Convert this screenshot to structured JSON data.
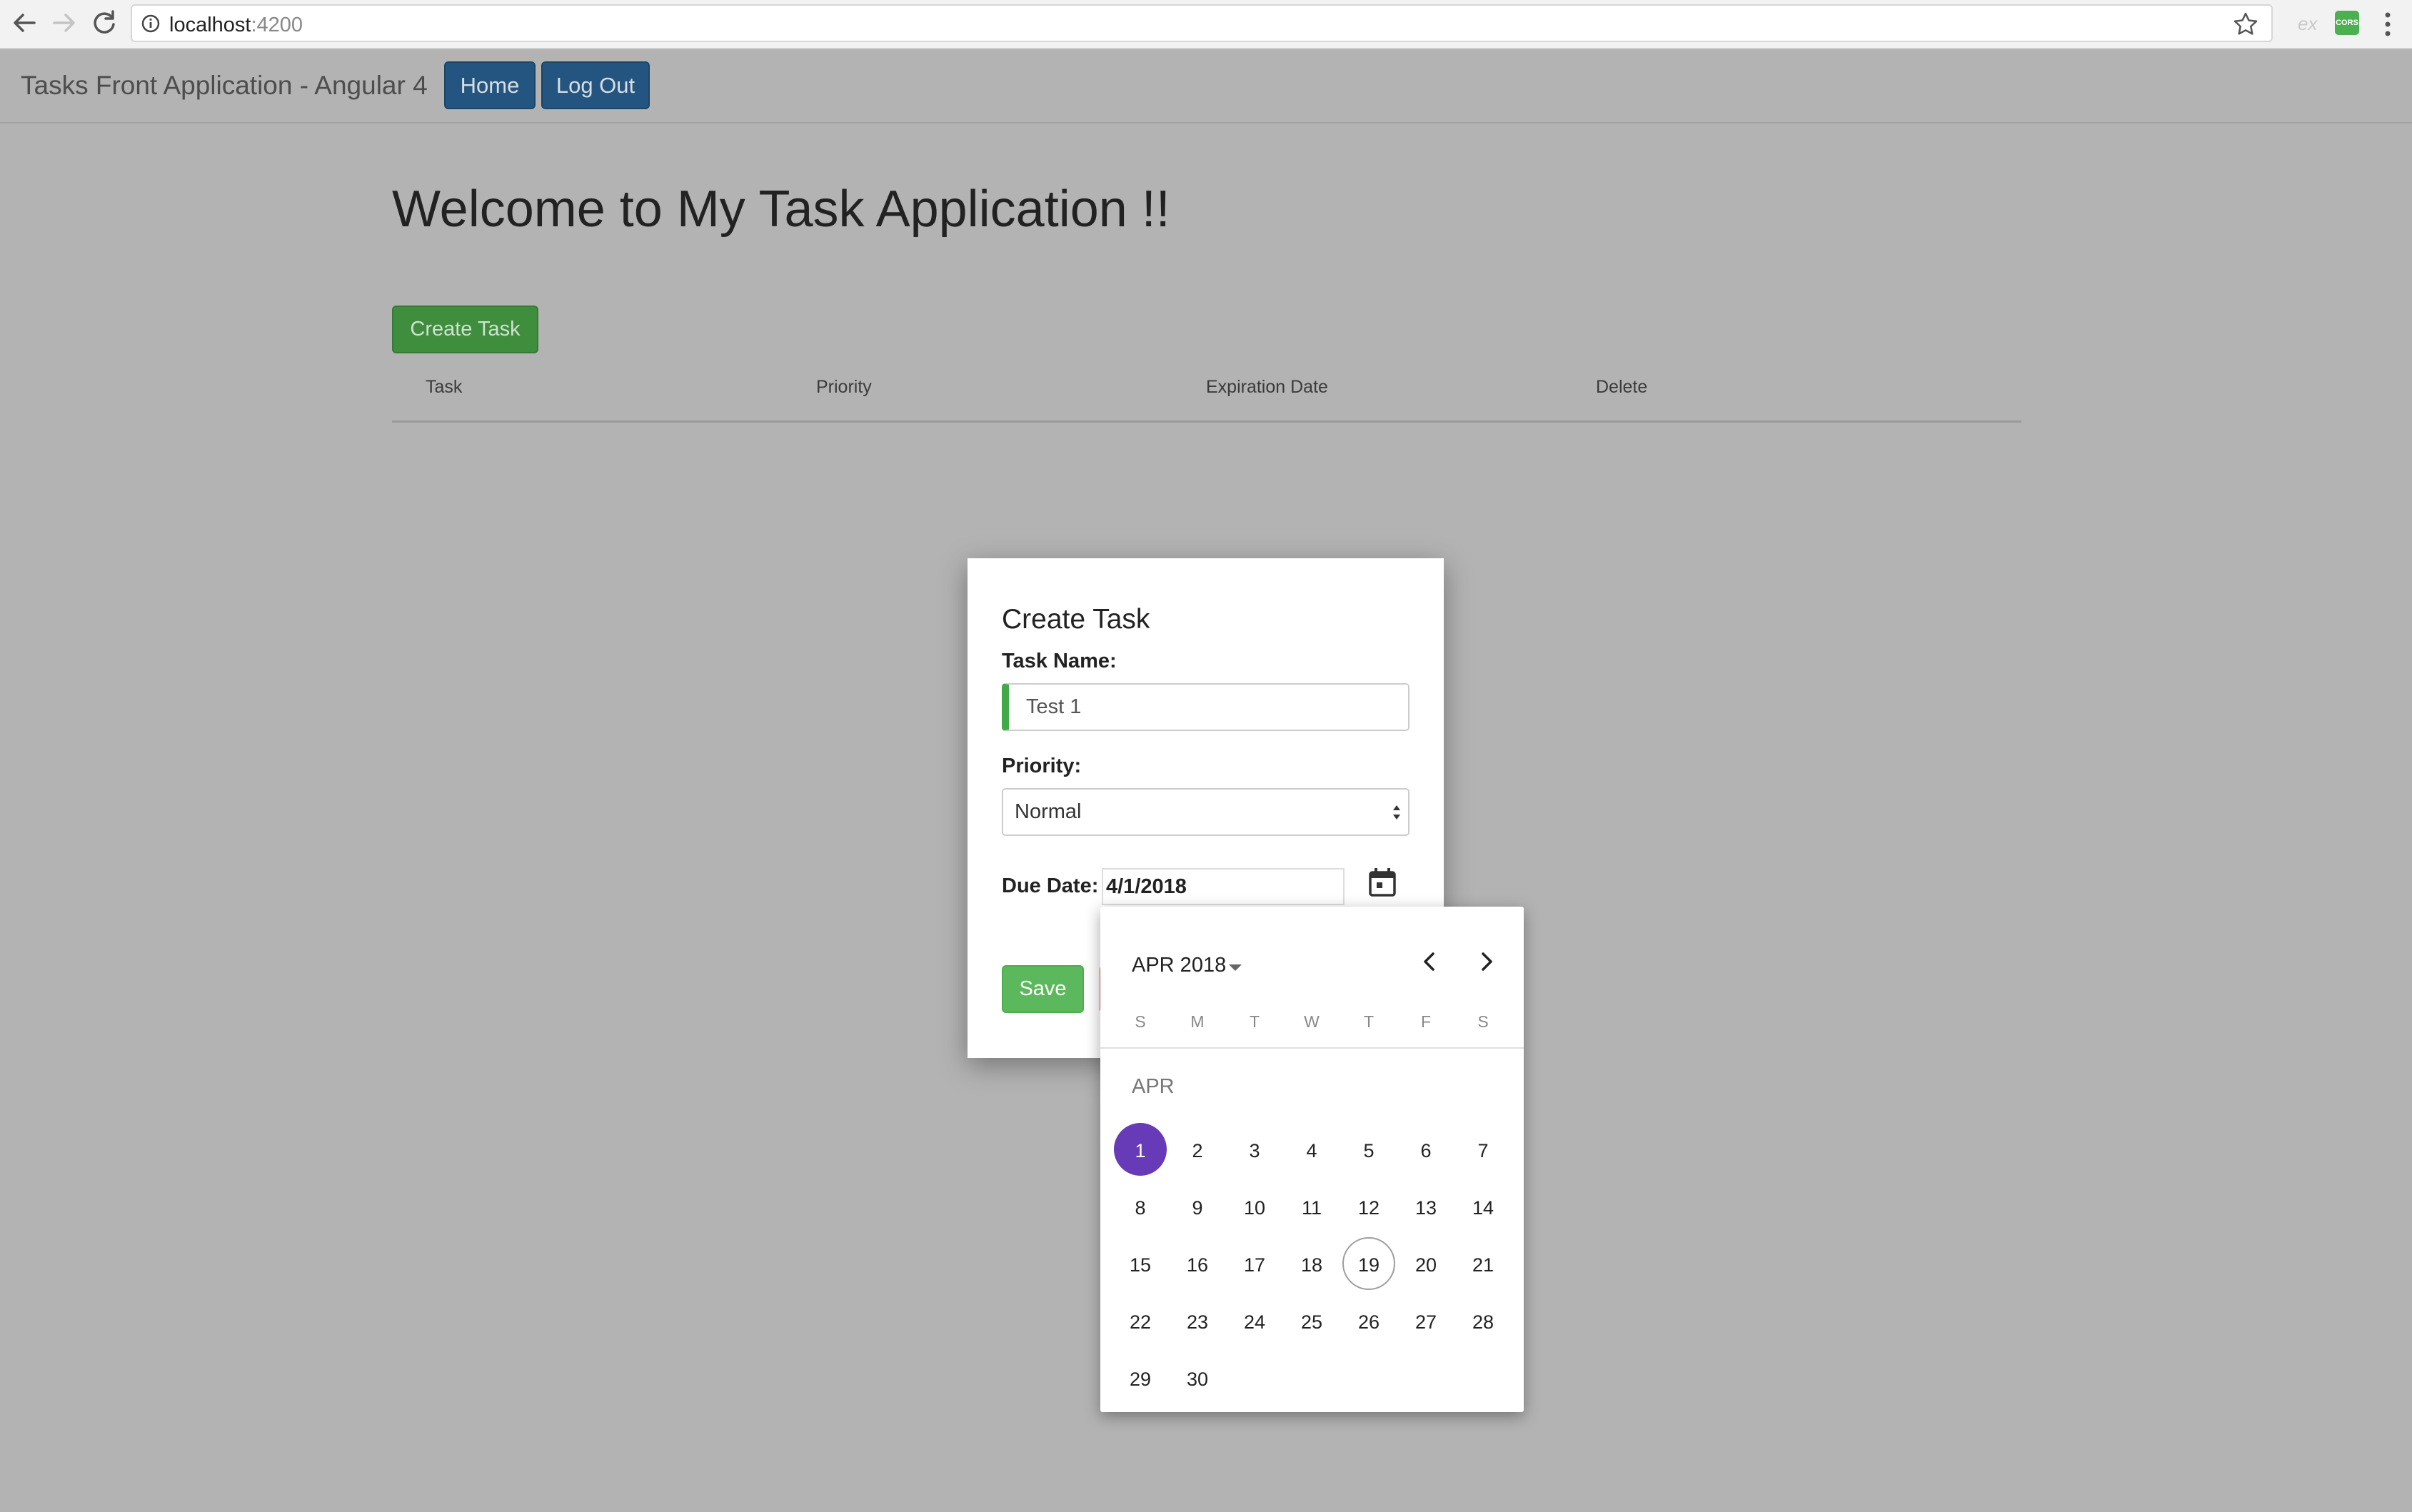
{
  "browser": {
    "url_host": "localhost",
    "url_port": ":4200",
    "ext_ex_label": "ex",
    "ext_cors_label": "CORS"
  },
  "navbar": {
    "brand": "Tasks Front Application - Angular 4",
    "home_label": "Home",
    "logout_label": "Log Out"
  },
  "main": {
    "title": "Welcome to My Task Application !!",
    "create_label": "Create Task",
    "columns": [
      "Task",
      "Priority",
      "Expiration Date",
      "Delete"
    ]
  },
  "modal": {
    "title": "Create Task",
    "task_name_label": "Task Name:",
    "task_name_value": "Test 1",
    "priority_label": "Priority:",
    "priority_value": "Normal",
    "due_date_label": "Due Date:",
    "due_date_value": "4/1/2018",
    "save_label": "Save"
  },
  "datepicker": {
    "period_label": "APR 2018",
    "weekdays": [
      "S",
      "M",
      "T",
      "W",
      "T",
      "F",
      "S"
    ],
    "month_label": "APR",
    "days": [
      "1",
      "2",
      "3",
      "4",
      "5",
      "6",
      "7",
      "8",
      "9",
      "10",
      "11",
      "12",
      "13",
      "14",
      "15",
      "16",
      "17",
      "18",
      "19",
      "20",
      "21",
      "22",
      "23",
      "24",
      "25",
      "26",
      "27",
      "28",
      "29",
      "30"
    ],
    "selected_day": "1",
    "today_day": "19",
    "selected_color": "#673ab7"
  },
  "icons": {
    "back": "arrow-left-icon",
    "forward": "arrow-right-icon",
    "reload": "reload-icon",
    "info": "info-icon",
    "bookmark": "star-icon",
    "menu": "kebab-menu-icon",
    "calendar": "calendar-icon",
    "prev": "chevron-left-icon",
    "next": "chevron-right-icon",
    "dropdown": "caret-down-icon"
  }
}
